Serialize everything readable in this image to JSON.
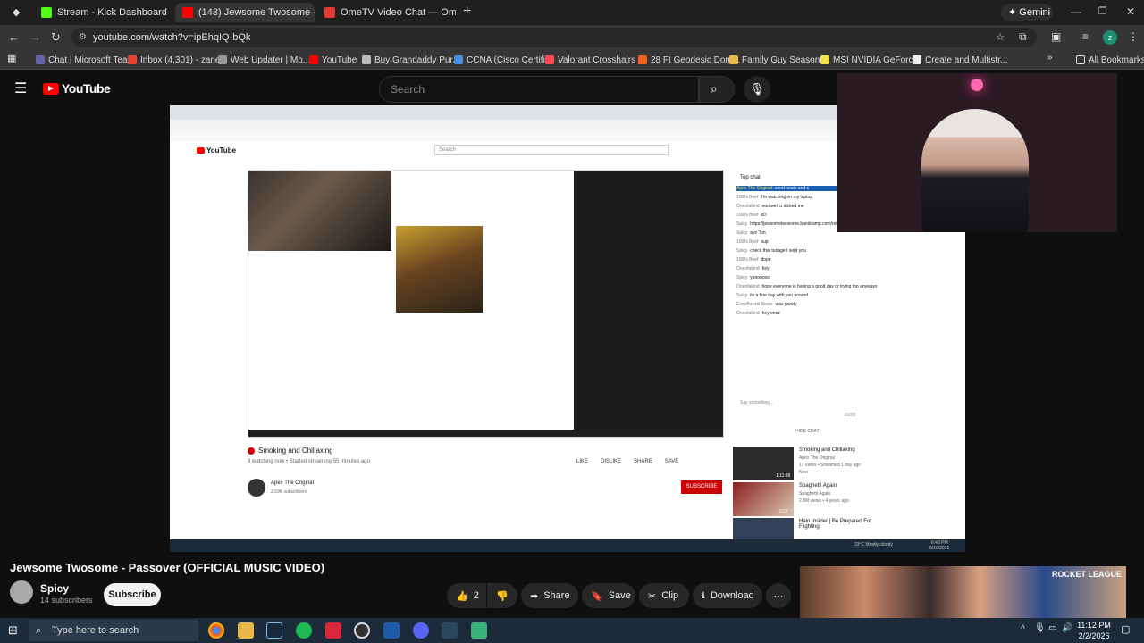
{
  "tabs": [
    {
      "label": "Stream - Kick Dashboard",
      "color": "#53fc18"
    },
    {
      "label": "(143) Jewsome Twosome - I",
      "color": "#ff0000"
    },
    {
      "label": "OmeTV Video Chat — Omegle",
      "color": "#e53935"
    }
  ],
  "gemini": "Gemini",
  "url": "youtube.com/watch?v=ipEhqIQ-bQk",
  "bookmarks": [
    "Chat | Microsoft Tea...",
    "Inbox (4,301) - zane...",
    "Web Updater | Mo...",
    "YouTube",
    "Buy Grandaddy Pur...",
    "CCNA (Cisco Certifi...",
    "Valorant Crosshairs |...",
    "28 Ft Geodesic Dom...",
    "Family Guy Season...",
    "MSI NVIDIA GeForc...",
    "Create and Multistr..."
  ],
  "all_bookmarks": "All Bookmarks",
  "yt_logo": "YouTube",
  "search_placeholder": "Search",
  "inner": {
    "yt_logo": "YouTube",
    "search_placeholder": "Search",
    "stream_title": "Smoking and Chillaxing",
    "stream_meta": "3 watching now • Started streaming 55 minutes ago",
    "channel": "Apex The Original",
    "subs": "2.59K subscribers",
    "actions": [
      "LIKE",
      "DISLIKE",
      "SHARE",
      "SAVE"
    ],
    "subscribe": "SUBSCRIBE",
    "top_chat": "Top chat",
    "chat": [
      {
        "user": "Apex The Original",
        "msg": "send beats and s"
      },
      {
        "user": "100% Beef",
        "msg": "I'm watching on my laptop"
      },
      {
        "user": "Oneofakind",
        "msg": "ooo well u tricked me"
      },
      {
        "user": "100% Beef",
        "msg": "xD"
      },
      {
        "user": "Spicy",
        "msg": "https://jewsometwosome.bandcamp.com/releases"
      },
      {
        "user": "Spicy",
        "msg": "ayo Ton"
      },
      {
        "user": "100% Beef",
        "msg": "sup"
      },
      {
        "user": "Spicy",
        "msg": "check that tunage I sent you"
      },
      {
        "user": "100% Beef",
        "msg": "dope"
      },
      {
        "user": "Oneofakind",
        "msg": "hey"
      },
      {
        "user": "Spicy",
        "msg": "yooooooo"
      },
      {
        "user": "Oneofakind",
        "msg": "hope everyone is having a good day or trying too anyways"
      },
      {
        "user": "Spicy",
        "msg": "its a fine day with you around"
      },
      {
        "user": "EnozBazzel Beats",
        "msg": "was goody"
      },
      {
        "user": "Oneofakind",
        "msg": "hey enoz"
      }
    ],
    "chat_input": "Say something...",
    "chat_count": "0/200",
    "hide_chat": "HIDE CHAT",
    "recs": [
      {
        "title": "Smoking and Chillaxing",
        "channel": "Apex The Original",
        "meta": "17 views • Streamed 1 day ago",
        "dur": "1:11:38",
        "badge": "New"
      },
      {
        "title": "Spaghetti Again",
        "channel": "Spaghetti Again",
        "meta": "2.8M views • 4 years ago",
        "dur": "2:57",
        "badge": ""
      },
      {
        "title": "Halo Insider | Be Prepared For Flighting",
        "channel": "",
        "meta": "",
        "dur": "",
        "badge": ""
      }
    ],
    "inner_tray_time": "6:48 PM",
    "inner_tray_date": "6/10/2021",
    "inner_weather": "23°C Mostly cloudy"
  },
  "video": {
    "title": "Jewsome Twosome - Passover (OFFICIAL MUSIC VIDEO)",
    "channel": "Spicy",
    "subs": "14 subscribers",
    "subscribe": "Subscribe",
    "likes": "2",
    "share": "Share",
    "save": "Save",
    "clip": "Clip",
    "download": "Download"
  },
  "overlay_text": "ROCKET LEAGUE",
  "taskbar": {
    "search": "Type here to search",
    "time": "11:12 PM",
    "date": "2/2/2026"
  }
}
